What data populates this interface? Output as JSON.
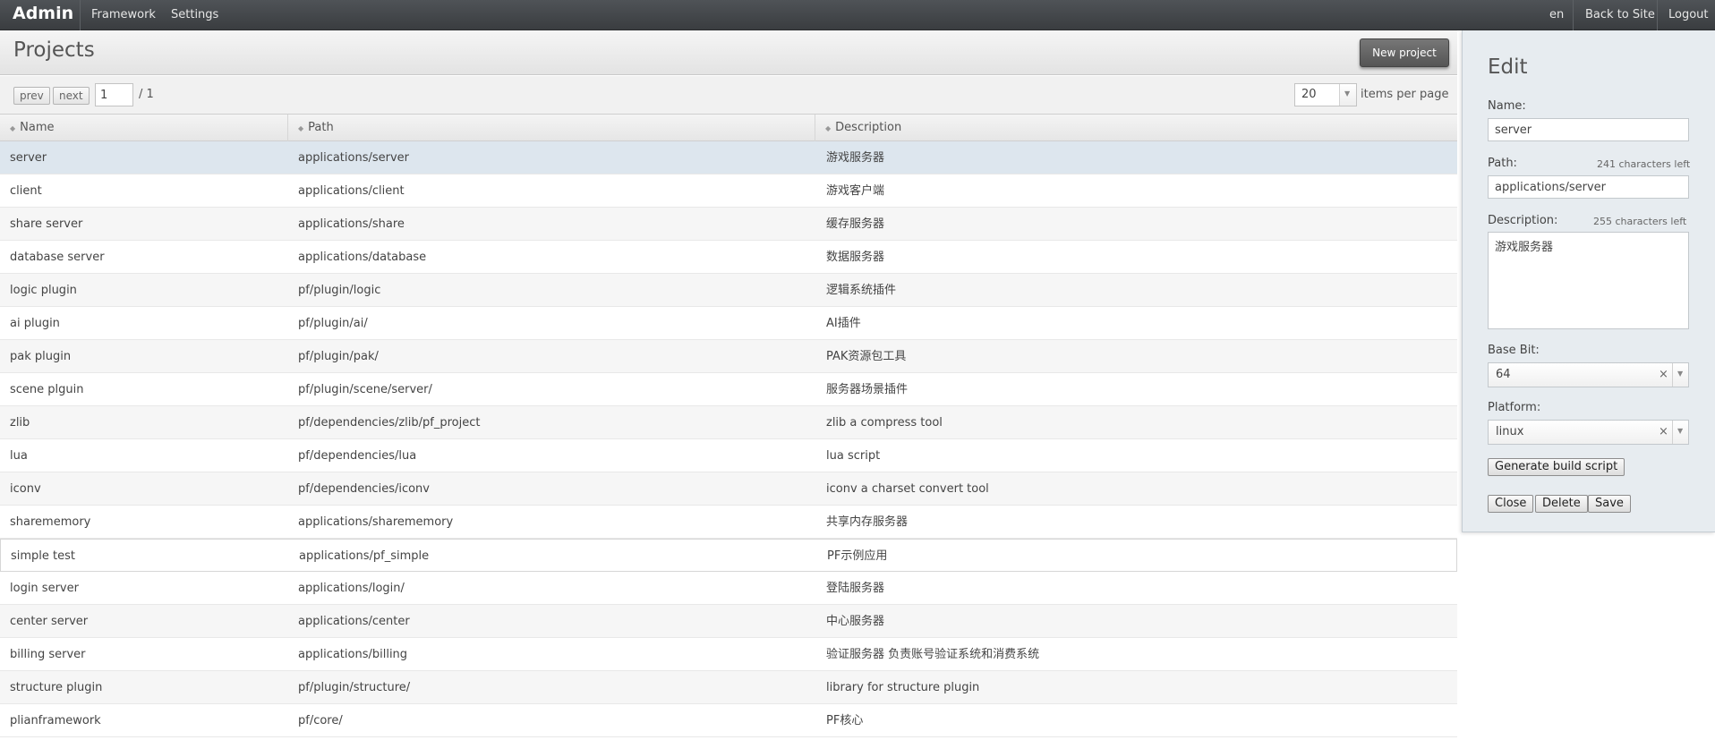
{
  "topbar": {
    "brand": "Admin",
    "nav": [
      "Framework",
      "Settings"
    ],
    "right": [
      "en",
      "Back to Site",
      "Logout"
    ]
  },
  "header": {
    "title": "Projects",
    "new_button": "New project"
  },
  "pager": {
    "prev": "prev",
    "next": "next",
    "page": "1",
    "total": "/ 1",
    "per_page": "20",
    "per_page_label": "items per page"
  },
  "table": {
    "columns": [
      "Name",
      "Path",
      "Description"
    ],
    "rows": [
      {
        "name": "server",
        "path": "applications/server",
        "desc": "游戏服务器"
      },
      {
        "name": "client",
        "path": "applications/client",
        "desc": "游戏客户端"
      },
      {
        "name": "share server",
        "path": "applications/share",
        "desc": "缓存服务器"
      },
      {
        "name": "database server",
        "path": "applications/database",
        "desc": "数据服务器"
      },
      {
        "name": "logic plugin",
        "path": "pf/plugin/logic",
        "desc": "逻辑系统插件"
      },
      {
        "name": "ai plugin",
        "path": "pf/plugin/ai/",
        "desc": "AI插件"
      },
      {
        "name": "pak plugin",
        "path": "pf/plugin/pak/",
        "desc": "PAK资源包工具"
      },
      {
        "name": "scene plguin",
        "path": "pf/plugin/scene/server/",
        "desc": "服务器场景插件"
      },
      {
        "name": "zlib",
        "path": "pf/dependencies/zlib/pf_project",
        "desc": "zlib a compress tool"
      },
      {
        "name": "lua",
        "path": "pf/dependencies/lua",
        "desc": "lua script"
      },
      {
        "name": "iconv",
        "path": "pf/dependencies/iconv",
        "desc": "iconv a charset convert tool"
      },
      {
        "name": "sharememory",
        "path": "applications/sharememory",
        "desc": "共享内存服务器"
      },
      {
        "name": "simple test",
        "path": "applications/pf_simple",
        "desc": "PF示例应用"
      },
      {
        "name": "login server",
        "path": "applications/login/",
        "desc": "登陆服务器"
      },
      {
        "name": "center server",
        "path": "applications/center",
        "desc": "中心服务器"
      },
      {
        "name": "billing server",
        "path": "applications/billing",
        "desc": "验证服务器 负责账号验证系统和消费系统"
      },
      {
        "name": "structure plugin",
        "path": "pf/plugin/structure/",
        "desc": "library for structure plugin"
      },
      {
        "name": "plianframework",
        "path": "pf/core/",
        "desc": "PF核心"
      }
    ]
  },
  "edit": {
    "title": "Edit",
    "name_label": "Name:",
    "name_value": "server",
    "path_label": "Path:",
    "path_counter": "241 characters left",
    "path_value": "applications/server",
    "desc_label": "Description:",
    "desc_counter": "255 characters left",
    "desc_value": "游戏服务器",
    "basebit_label": "Base Bit:",
    "basebit_value": "64",
    "platform_label": "Platform:",
    "platform_value": "linux",
    "clear_glyph": "×",
    "generate_button": "Generate build script",
    "close_button": "Close",
    "delete_button": "Delete",
    "save_button": "Save"
  }
}
